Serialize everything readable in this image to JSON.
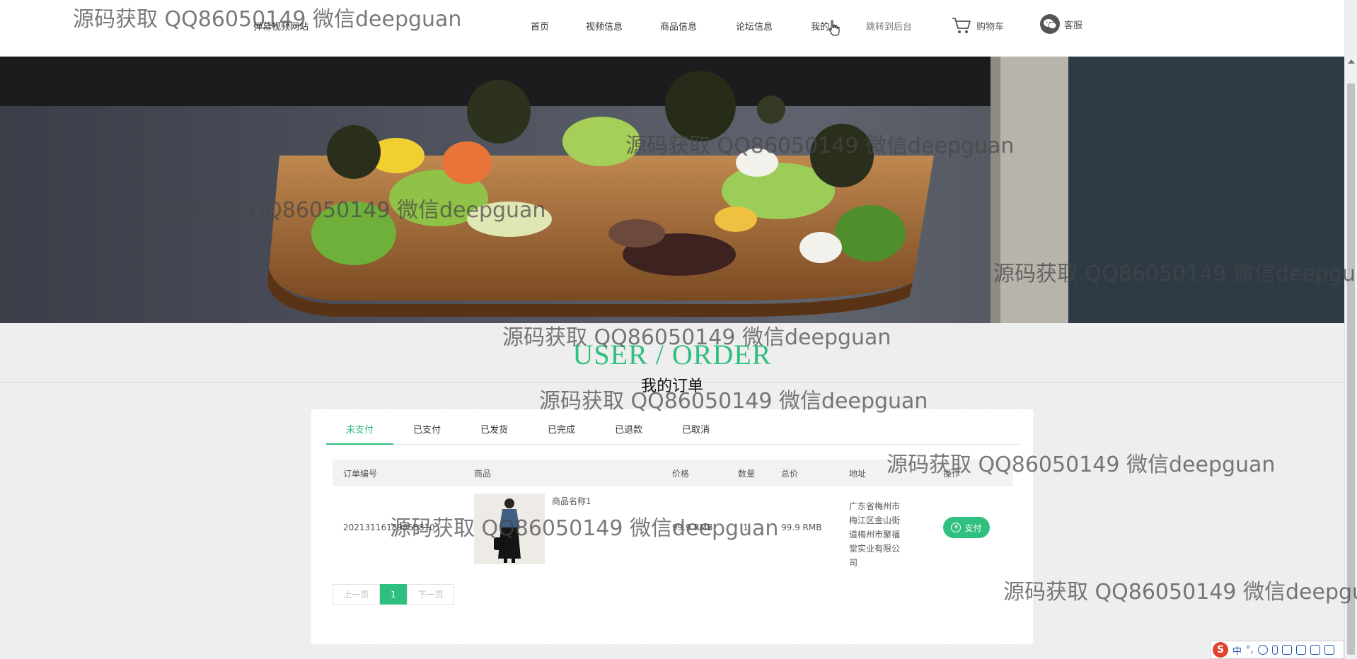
{
  "header": {
    "site_name": "弹幕视频网站",
    "nav": [
      "首页",
      "视频信息",
      "商品信息",
      "论坛信息",
      "我的",
      "跳转到后台"
    ],
    "cart_label": "购物车",
    "service_label": "客服"
  },
  "page": {
    "title_en": "USER / ORDER",
    "title_cn": "我的订单"
  },
  "orders": {
    "tabs": [
      "未支付",
      "已支付",
      "已发货",
      "已完成",
      "已退款",
      "已取消"
    ],
    "active_tab": 0,
    "columns": [
      "订单编号",
      "商品",
      "价格",
      "数量",
      "总价",
      "地址",
      "操作"
    ],
    "rows": [
      {
        "order_no": "20213116189855810",
        "product_name": "商品名称1",
        "price": "99.9 RMB",
        "quantity": "1",
        "total": "99.9 RMB",
        "address": "广东省梅州市梅江区金山街道梅州市聚福堂实业有限公司",
        "action": "支付"
      }
    ],
    "pager": {
      "prev": "上一页",
      "current": "1",
      "next": "下一页"
    }
  },
  "watermark": "源码获取 QQ86050149 微信deepguan",
  "ime": {
    "logo": "S",
    "mode": "中"
  },
  "colors": {
    "accent": "#2fbf7e",
    "background": "#eeeeee"
  }
}
